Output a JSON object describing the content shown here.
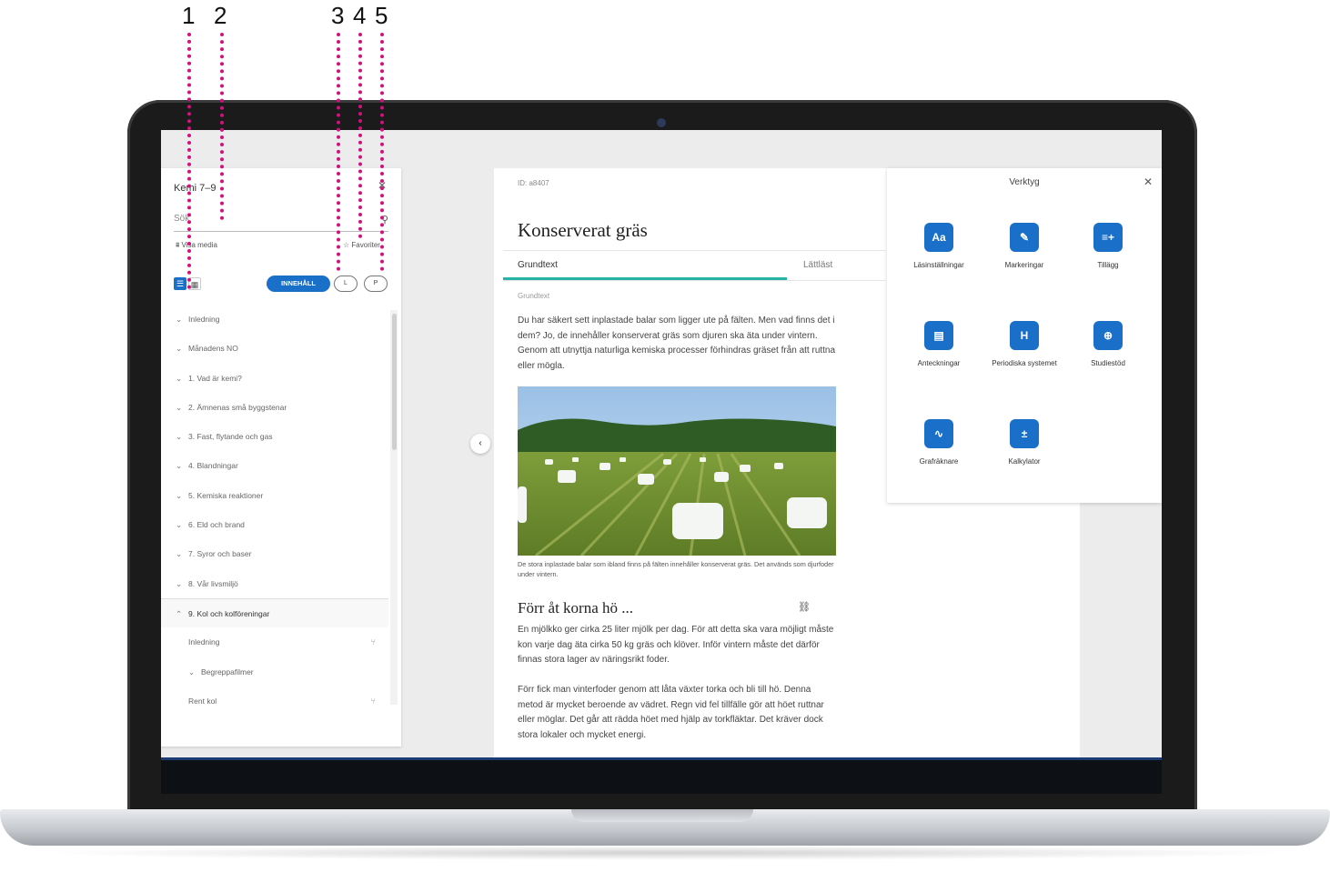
{
  "callouts": [
    "1",
    "2",
    "3",
    "4",
    "5"
  ],
  "sidebar": {
    "title": "Kemi 7–9",
    "search_placeholder": "Sök",
    "filter_label": "Visa media",
    "favorites_label": "Favoriter",
    "content_button": "INNEHÅLL",
    "l_button": "L",
    "p_button": "P",
    "toc": [
      {
        "label": "Inledning"
      },
      {
        "label": "Månadens NO"
      },
      {
        "label": "1. Vad är kemi?"
      },
      {
        "label": "2. Ämnenas små byggstenar"
      },
      {
        "label": "3. Fast, flytande och gas"
      },
      {
        "label": "4. Blandningar"
      },
      {
        "label": "5. Kemiska reaktioner"
      },
      {
        "label": "6. Eld och brand"
      },
      {
        "label": "7. Syror och baser"
      },
      {
        "label": "8. Vår livsmiljö"
      },
      {
        "label": "9. Kol och kolföreningar"
      },
      {
        "label": "Inledning"
      },
      {
        "label": "Begreppafilmer"
      },
      {
        "label": "Rent kol"
      }
    ]
  },
  "article": {
    "id_label": "ID:",
    "id_value": "a8407",
    "title": "Konserverat gräs",
    "tab_active": "Grundtext",
    "tab_other": "Lättläst",
    "section_label": "Grundtext",
    "intro": "Du har säkert sett inplastade balar som ligger ute på fälten. Men vad finns det i dem? Jo, de innehåller konserverat gräs som djuren ska äta under vintern. Genom att utnyttja naturliga kemiska processer förhindras gräset från att ruttna eller mögla.",
    "caption": "De stora inplastade balar som ibland finns på fälten innehåller konserverat gräs. Det används som djurfoder under vintern.",
    "heading2": "Förr åt korna hö ...",
    "para2": "En mjölkko ger cirka 25 liter mjölk per dag. För att detta ska vara möjligt måste kon varje dag äta cirka 50 kg gräs och klöver. Inför vintern måste det därför finnas stora lager av näringsrikt foder.",
    "para3": "Förr fick man vinterfoder genom att låta växter torka och bli till hö. Denna metod är mycket beroende av vädret. Regn vid fel tillfälle gör att höet ruttnar eller möglar. Det går att rädda höet med hjälp av torkfläktar. Det kräver dock stora lokaler och mycket energi."
  },
  "tools": {
    "title": "Verktyg",
    "items": [
      {
        "label": "Läsinställningar",
        "glyph": "Aa",
        "icon": "text-settings-icon"
      },
      {
        "label": "Markeringar",
        "glyph": "✎",
        "icon": "highlighter-icon"
      },
      {
        "label": "Tillägg",
        "glyph": "≡+",
        "icon": "add-list-icon"
      },
      {
        "label": "Anteckningar",
        "glyph": "▤",
        "icon": "notes-icon"
      },
      {
        "label": "Periodiska systemet",
        "glyph": "H",
        "icon": "periodic-table-icon"
      },
      {
        "label": "Studiestöd",
        "glyph": "⊕",
        "icon": "globe-icon"
      },
      {
        "label": "Grafräknare",
        "glyph": "∿",
        "icon": "graph-calculator-icon"
      },
      {
        "label": "Kalkylator",
        "glyph": "±",
        "icon": "calculator-icon"
      }
    ]
  },
  "colors": {
    "accent": "#1a6fc9",
    "tab_underline": "#27b3a5",
    "callout": "#d0127f"
  }
}
